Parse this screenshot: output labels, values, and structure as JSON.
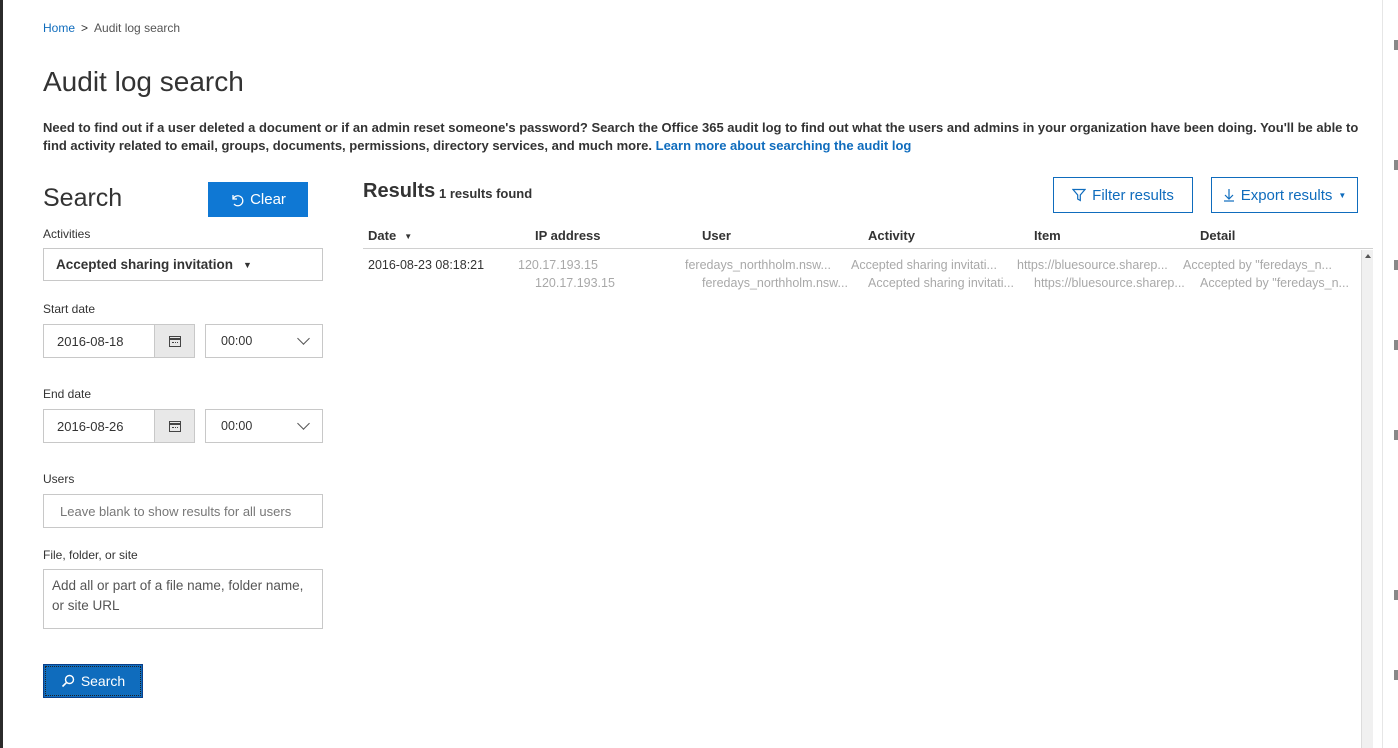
{
  "breadcrumb": {
    "home": "Home",
    "separator": ">",
    "current": "Audit log search"
  },
  "page_title": "Audit log search",
  "intro": {
    "text": "Need to find out if a user deleted a document or if an admin reset someone's password? Search the Office 365 audit log to find out what the users and admins in your organization have been doing. You'll be able to find activity related to email, groups, documents, permissions, directory services, and much more. ",
    "link": "Learn more about searching the audit log"
  },
  "search_panel": {
    "heading": "Search",
    "clear_label": "Clear",
    "activities_label": "Activities",
    "activities_value": "Accepted sharing invitation",
    "start_date_label": "Start date",
    "start_date": "2016-08-18",
    "start_time": "00:00",
    "end_date_label": "End date",
    "end_date": "2016-08-26",
    "end_time": "00:00",
    "users_label": "Users",
    "users_placeholder": "Leave blank to show results for all users",
    "file_label": "File, folder, or site",
    "file_placeholder": "Add all or part of a file name, folder name, or site URL",
    "search_label": "Search"
  },
  "results": {
    "heading": "Results",
    "count": "1 results found",
    "filter_label": "Filter results",
    "export_label": "Export results",
    "columns": [
      "Date",
      "IP address",
      "User",
      "Activity",
      "Item",
      "Detail"
    ],
    "rows": [
      {
        "date": "2016-08-23 08:18:21",
        "ip": "120.17.193.15",
        "user": "feredays_northholm.nsw...",
        "activity": "Accepted sharing invitati...",
        "item": "https://bluesource.sharep...",
        "detail": "Accepted by \"feredays_n..."
      }
    ]
  },
  "colors": {
    "accent": "#0f6cbd",
    "primary_button": "#0f78d4"
  },
  "icons": {
    "clear": "undo-arrow-icon",
    "calendar": "calendar-icon",
    "search": "magnifier-icon",
    "filter": "funnel-icon",
    "export": "download-arrow-icon"
  }
}
